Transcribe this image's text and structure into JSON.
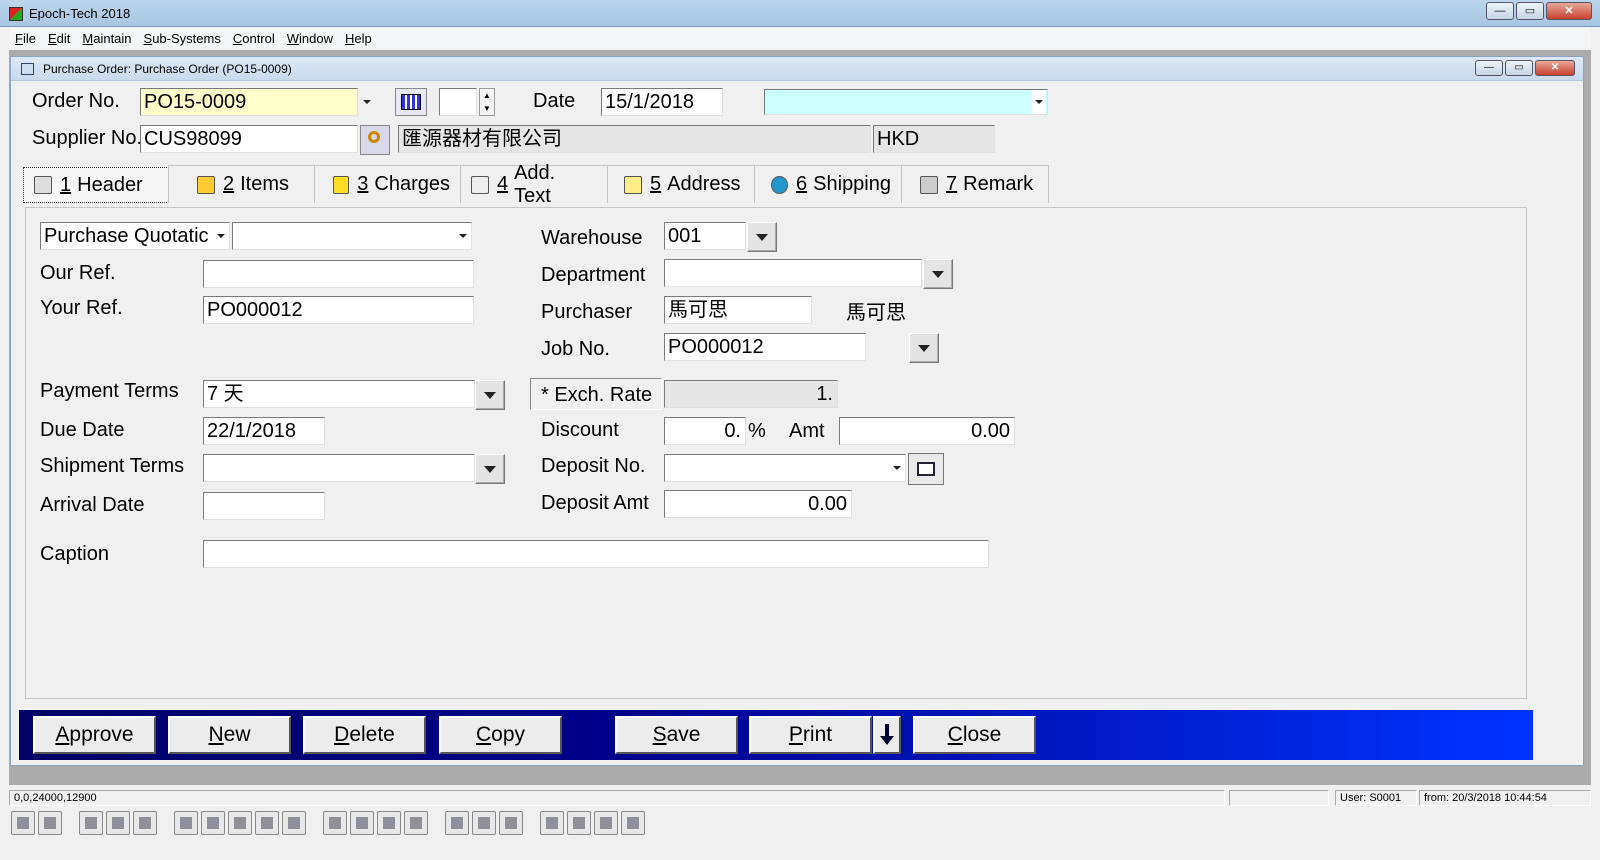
{
  "window": {
    "title": "Epoch-Tech 2018",
    "min": "—",
    "max": "▭",
    "close": "✕"
  },
  "menu": [
    "File",
    "Edit",
    "Maintain",
    "Sub-Systems",
    "Control",
    "Window",
    "Help"
  ],
  "child": {
    "title": "Purchase Order: Purchase Order (PO15-0009)"
  },
  "header": {
    "order_no_label": "Order No.",
    "order_no": "PO15-0009",
    "date_label": "Date",
    "date": "15/1/2018",
    "supplier_no_label": "Supplier No.",
    "supplier_no": "CUS98099",
    "supplier_name": "匯源器材有限公司",
    "currency": "HKD"
  },
  "tabs": [
    {
      "num": "1",
      "label": "Header",
      "icon": "header-icon"
    },
    {
      "num": "2",
      "label": "Items",
      "icon": "items-icon"
    },
    {
      "num": "3",
      "label": "Charges",
      "icon": "charges-icon"
    },
    {
      "num": "4",
      "label": "Add. Text",
      "icon": "add-text-icon"
    },
    {
      "num": "5",
      "label": "Address",
      "icon": "address-icon"
    },
    {
      "num": "6",
      "label": "Shipping",
      "icon": "globe-icon"
    },
    {
      "num": "7",
      "label": "Remark",
      "icon": "remark-icon"
    }
  ],
  "form": {
    "doc_type": "Purchase Quotatic",
    "our_ref_label": "Our Ref.",
    "our_ref": "",
    "your_ref_label": "Your Ref.",
    "your_ref": "PO000012",
    "payment_terms_label": "Payment Terms",
    "payment_terms": "7 天",
    "due_date_label": "Due Date",
    "due_date": "22/1/2018",
    "shipment_terms_label": "Shipment Terms",
    "shipment_terms": "",
    "arrival_date_label": "Arrival Date",
    "arrival_date": "",
    "caption_label": "Caption",
    "caption": "",
    "warehouse_label": "Warehouse",
    "warehouse": "001",
    "department_label": "Department",
    "department": "",
    "purchaser_label": "Purchaser",
    "purchaser": "馬可思",
    "purchaser_name": "馬可思",
    "job_no_label": "Job No.",
    "job_no": "PO000012",
    "exch_rate_label": "* Exch. Rate",
    "exch_rate": "1.",
    "discount_label": "Discount",
    "discount": "0.",
    "percent": "%",
    "amt_label": "Amt",
    "amt": "0.00",
    "deposit_no_label": "Deposit No.",
    "deposit_no": "",
    "deposit_amt_label": "Deposit Amt",
    "deposit_amt": "0.00"
  },
  "actions": {
    "approve": "Approve",
    "new": "New",
    "delete": "Delete",
    "copy": "Copy",
    "save": "Save",
    "print": "Print",
    "close": "Close"
  },
  "status": {
    "coords": "0,0,24000,12900",
    "user": "User: S0001",
    "from": "from: 20/3/2018 10:44:54"
  },
  "icons": [
    "exit-icon",
    "lock-icon",
    "printer-icon",
    "preview-icon",
    "scanner-icon",
    "undo-icon",
    "cut-icon",
    "copy-icon",
    "paste-icon",
    "font-icon",
    "prev-icon",
    "next-icon",
    "find-icon",
    "find-next-icon",
    "windows-icon",
    "zoom-in-icon",
    "zoom-out-icon",
    "money-icon",
    "flag-icon",
    "calculator-icon",
    "report-icon"
  ]
}
